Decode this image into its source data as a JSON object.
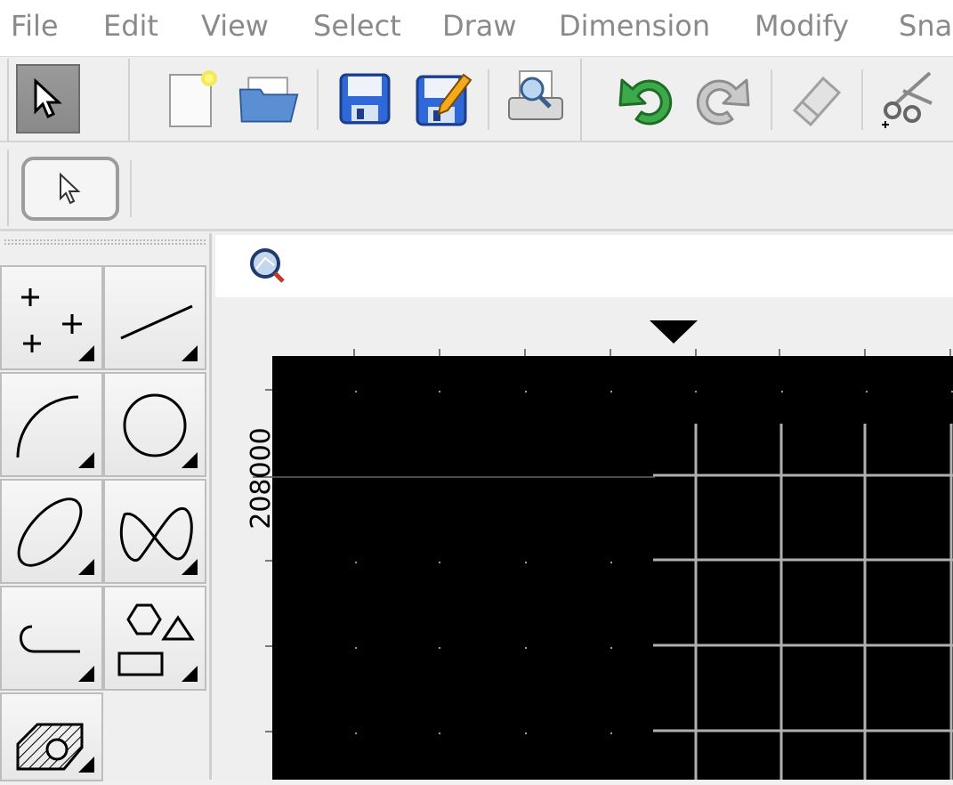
{
  "menu": {
    "items": [
      "File",
      "Edit",
      "View",
      "Select",
      "Draw",
      "Dimension",
      "Modify",
      "Snap"
    ]
  },
  "toolbar": {
    "buttons": [
      "pointer-icon",
      "new-document-icon",
      "open-folder-icon",
      "save-icon",
      "save-as-icon",
      "print-preview-icon",
      "undo-icon",
      "redo-icon",
      "eraser-icon",
      "cut-icon"
    ]
  },
  "ruler": {
    "y_label": "208000"
  },
  "colors": {
    "canvas_background": "#000000",
    "grid_lines": "#b0b0b0",
    "undo_green": "#2e9b3a"
  }
}
